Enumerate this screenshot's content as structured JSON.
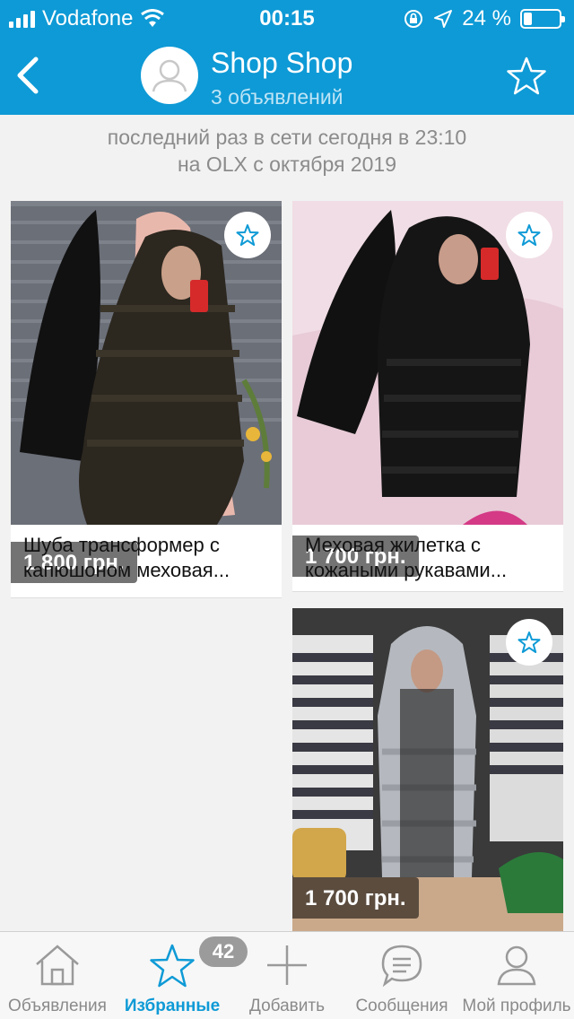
{
  "status_bar": {
    "carrier": "Vodafone",
    "time": "00:15",
    "battery": "24 %",
    "battery_level": 0.24
  },
  "header": {
    "title": "Shop Shop",
    "subtitle": "3 объявлений"
  },
  "last_seen": {
    "line1": "последний раз в сети сегодня в 23:10",
    "line2": "на OLX с октября 2019"
  },
  "listings": [
    {
      "price": "1 800 грн.",
      "title_line1": "Шуба трансформер с",
      "title_line2": "капюшоном меховая..."
    },
    {
      "price": "1 700 грн.",
      "title_line1": "Меховая жилетка с",
      "title_line2": "кожаными рукавами..."
    },
    {
      "price": "1 700 грн."
    }
  ],
  "tabbar": {
    "items": [
      {
        "label": "Объявления",
        "icon": "house-icon"
      },
      {
        "label": "Избранные",
        "icon": "star-icon"
      },
      {
        "label": "Добавить",
        "icon": "plus-icon"
      },
      {
        "label": "Сообщения",
        "icon": "chat-icon"
      },
      {
        "label": "Мой профиль",
        "icon": "person-icon"
      }
    ],
    "favorites_badge": "42"
  },
  "colors": {
    "accent": "#0e9ad6",
    "tab_inactive": "#8a8a8a",
    "badge": "#9b9b9b"
  }
}
